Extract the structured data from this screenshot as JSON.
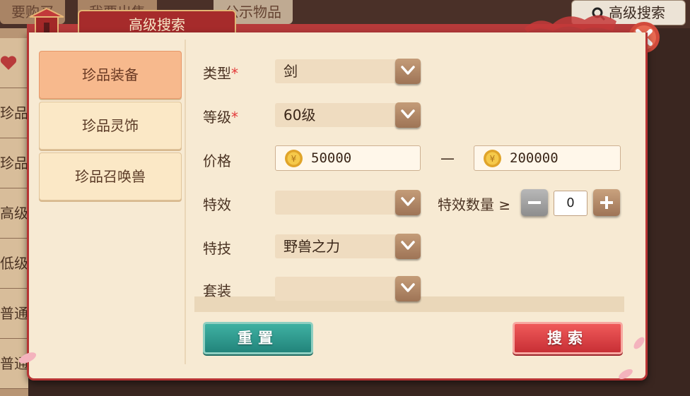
{
  "background": {
    "tabs": [
      "要购买",
      "我要出售",
      "公示物品"
    ],
    "advanced_search_button": "高级搜索",
    "left_items": [
      "",
      "珍品",
      "珍品",
      "高级",
      "低级",
      "普通",
      "普通"
    ]
  },
  "modal": {
    "title": "高级搜索",
    "nav": [
      {
        "label": "珍品装备",
        "active": true
      },
      {
        "label": "珍品灵饰",
        "active": false
      },
      {
        "label": "珍品召唤兽",
        "active": false
      }
    ],
    "form": {
      "type": {
        "label": "类型",
        "required_mark": "*",
        "value": "剑"
      },
      "level": {
        "label": "等级",
        "required_mark": "*",
        "value": "60级"
      },
      "price": {
        "label": "价格",
        "min": "50000",
        "separator": "—",
        "max": "200000"
      },
      "effect": {
        "label": "特效",
        "value": "",
        "count_label": "特效数量",
        "operator": "≥",
        "count": "0"
      },
      "skill": {
        "label": "特技",
        "value": "野兽之力"
      },
      "set": {
        "label": "套装",
        "value": ""
      }
    },
    "buttons": {
      "reset": "重置",
      "search": "搜索"
    }
  },
  "colors": {
    "accent_red": "#b73434",
    "panel": "#f7ead3",
    "reset": "#22847b",
    "search": "#c82f35"
  }
}
